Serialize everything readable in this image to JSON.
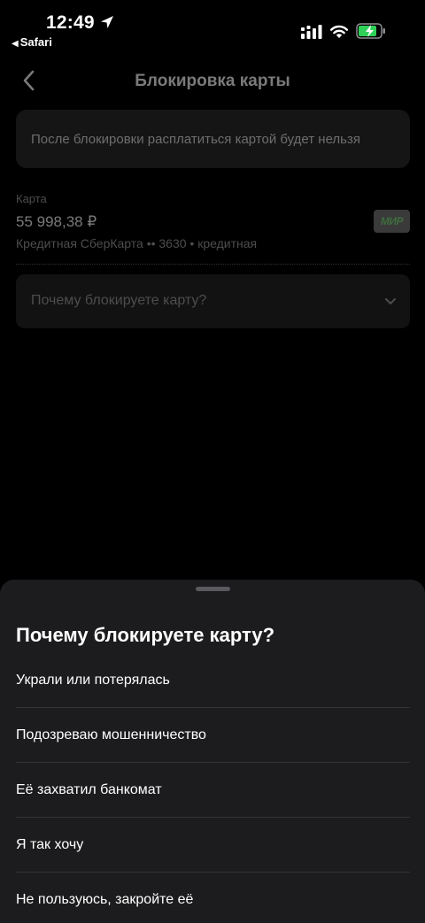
{
  "status_bar": {
    "time": "12:49",
    "back_app": "Safari",
    "icons": [
      "location-arrow-icon",
      "signal-icon",
      "wifi-icon",
      "battery-charging-icon"
    ]
  },
  "nav": {
    "title": "Блокировка карты",
    "back_icon": "chevron-left-icon"
  },
  "notice": {
    "text": "После блокировки расплатиться картой будет нельзя"
  },
  "card": {
    "label": "Карта",
    "amount": "55 998,38 ₽",
    "description": "Кредитная СберКарта •• 3630 • кредитная",
    "payment_system": "МИР"
  },
  "reason_select": {
    "placeholder": "Почему блокируете карту?",
    "icon": "chevron-down-icon"
  },
  "sheet": {
    "title": "Почему блокируете карту?",
    "options": [
      "Украли или потерялась",
      "Подозреваю мошенничество",
      "Её захватил банкомат",
      "Я так хочу",
      "Не пользуюсь, закройте её"
    ]
  },
  "colors": {
    "background": "#000000",
    "sheet": "#1c1c1e",
    "battery_charging": "#30d158"
  }
}
